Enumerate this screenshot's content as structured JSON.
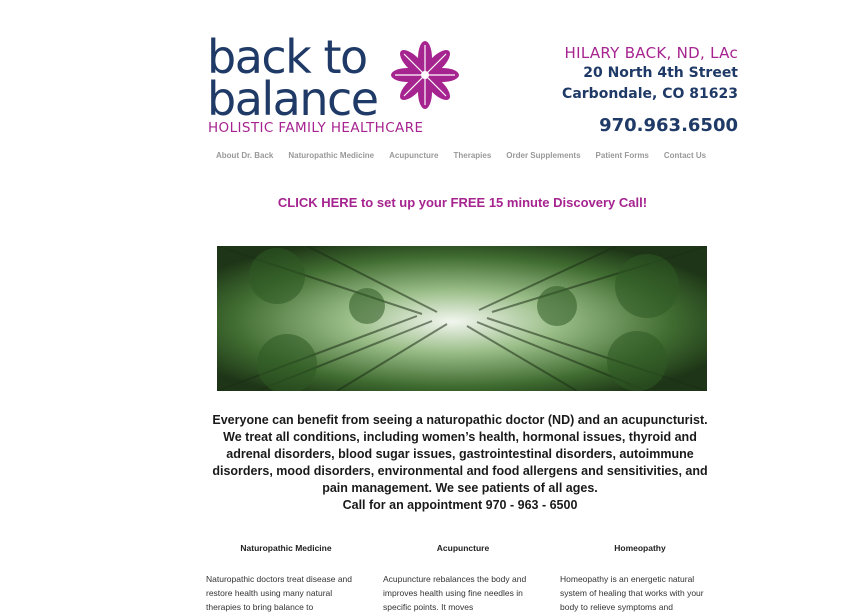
{
  "logo": {
    "line1": "back to",
    "line2": "balance",
    "subtitle": "HOLISTIC FAMILY HEALTHCARE"
  },
  "contact": {
    "name": "HILARY BACK, ND, LAc",
    "street": "20 North 4th Street",
    "city": "Carbondale, CO 81623",
    "phone": "970.963.6500"
  },
  "nav": [
    "About Dr. Back",
    "Naturopathic Medicine",
    "Acupuncture",
    "Therapies",
    "Order Supplements",
    "Patient Forms",
    "Contact Us"
  ],
  "cta": "CLICK HERE to set up your FREE 15 minute Discovery Call!",
  "intro": {
    "text": "Everyone can benefit from seeing a naturopathic doctor (ND) and an acupuncturist. We treat all conditions, including women’s health, hormonal issues, thyroid and adrenal disorders, blood sugar issues, gastrointestinal disorders, autoimmune disorders, mood disorders, environmental and food allergens and sensitivities, and pain management. We see patients of all ages.",
    "call": "Call for an appointment 970 - 963 - 6500"
  },
  "columns": [
    {
      "title": "Naturopathic Medicine",
      "text": "Naturopathic doctors treat disease and restore health using many natural therapies to bring balance to"
    },
    {
      "title": "Acupuncture",
      "text": "Acupuncture rebalances the body and improves health using fine needles in specific points. It moves"
    },
    {
      "title": "Homeopathy",
      "text": "Homeopathy is an energetic natural system of healing that works with your body to relieve symptoms and"
    }
  ],
  "colors": {
    "brand_navy": "#1f3a66",
    "brand_magenta": "#a6248f"
  }
}
